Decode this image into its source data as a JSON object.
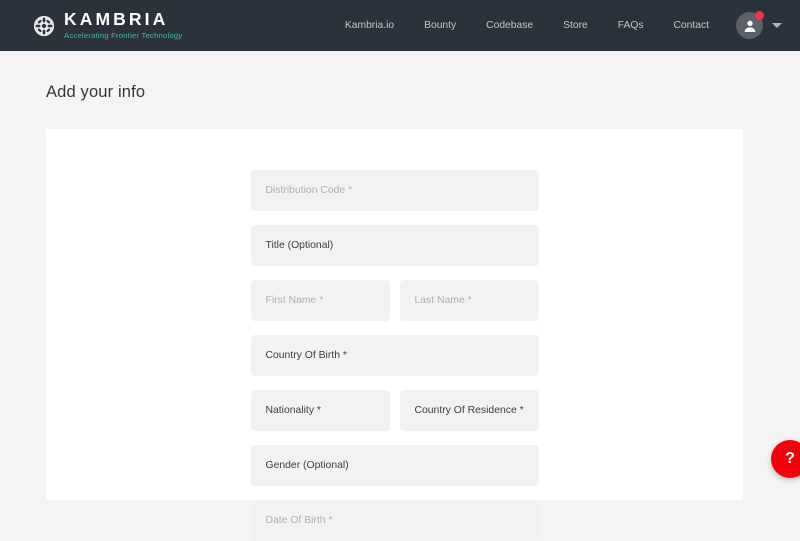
{
  "header": {
    "brand": {
      "name": "KAMBRIA",
      "tagline": "Accelerating Frontier Technology",
      "emblem_icon": "kambria-emblem-icon",
      "tagline_color": "#3dbba0",
      "bar_color": "#2b323c"
    },
    "nav_items": [
      {
        "label": "Kambria.io"
      },
      {
        "label": "Bounty"
      },
      {
        "label": "Codebase"
      },
      {
        "label": "Store"
      },
      {
        "label": "FAQs"
      },
      {
        "label": "Contact"
      }
    ],
    "account": {
      "avatar_icon": "user-avatar-icon",
      "notification_badge": true,
      "notification_color": "#f8314a",
      "caret_icon": "chevron-down-icon"
    }
  },
  "page": {
    "title": "Add your info",
    "background_color": "#f4f4f5",
    "card_color": "#ffffff"
  },
  "form": {
    "rows": [
      {
        "fields": [
          {
            "name": "distribution-code",
            "text": "Distribution Code *",
            "state": "placeholder"
          }
        ]
      },
      {
        "fields": [
          {
            "name": "title",
            "text": "Title (Optional)",
            "state": "filled"
          }
        ]
      },
      {
        "fields": [
          {
            "name": "first-name",
            "text": "First Name *",
            "state": "placeholder"
          },
          {
            "name": "last-name",
            "text": "Last Name *",
            "state": "placeholder"
          }
        ]
      },
      {
        "fields": [
          {
            "name": "country-of-birth",
            "text": "Country Of Birth *",
            "state": "filled"
          }
        ]
      },
      {
        "fields": [
          {
            "name": "nationality",
            "text": "Nationality *",
            "state": "filled"
          },
          {
            "name": "country-of-residence",
            "text": "Country Of Residence *",
            "state": "filled"
          }
        ]
      },
      {
        "fields": [
          {
            "name": "gender",
            "text": "Gender (Optional)",
            "state": "filled"
          }
        ]
      },
      {
        "fields": [
          {
            "name": "date-of-birth",
            "text": "Date Of Birth *",
            "state": "placeholder"
          }
        ]
      }
    ]
  },
  "help_button": {
    "label": "?",
    "icon": "question-mark-icon",
    "color": "#f4010e"
  }
}
